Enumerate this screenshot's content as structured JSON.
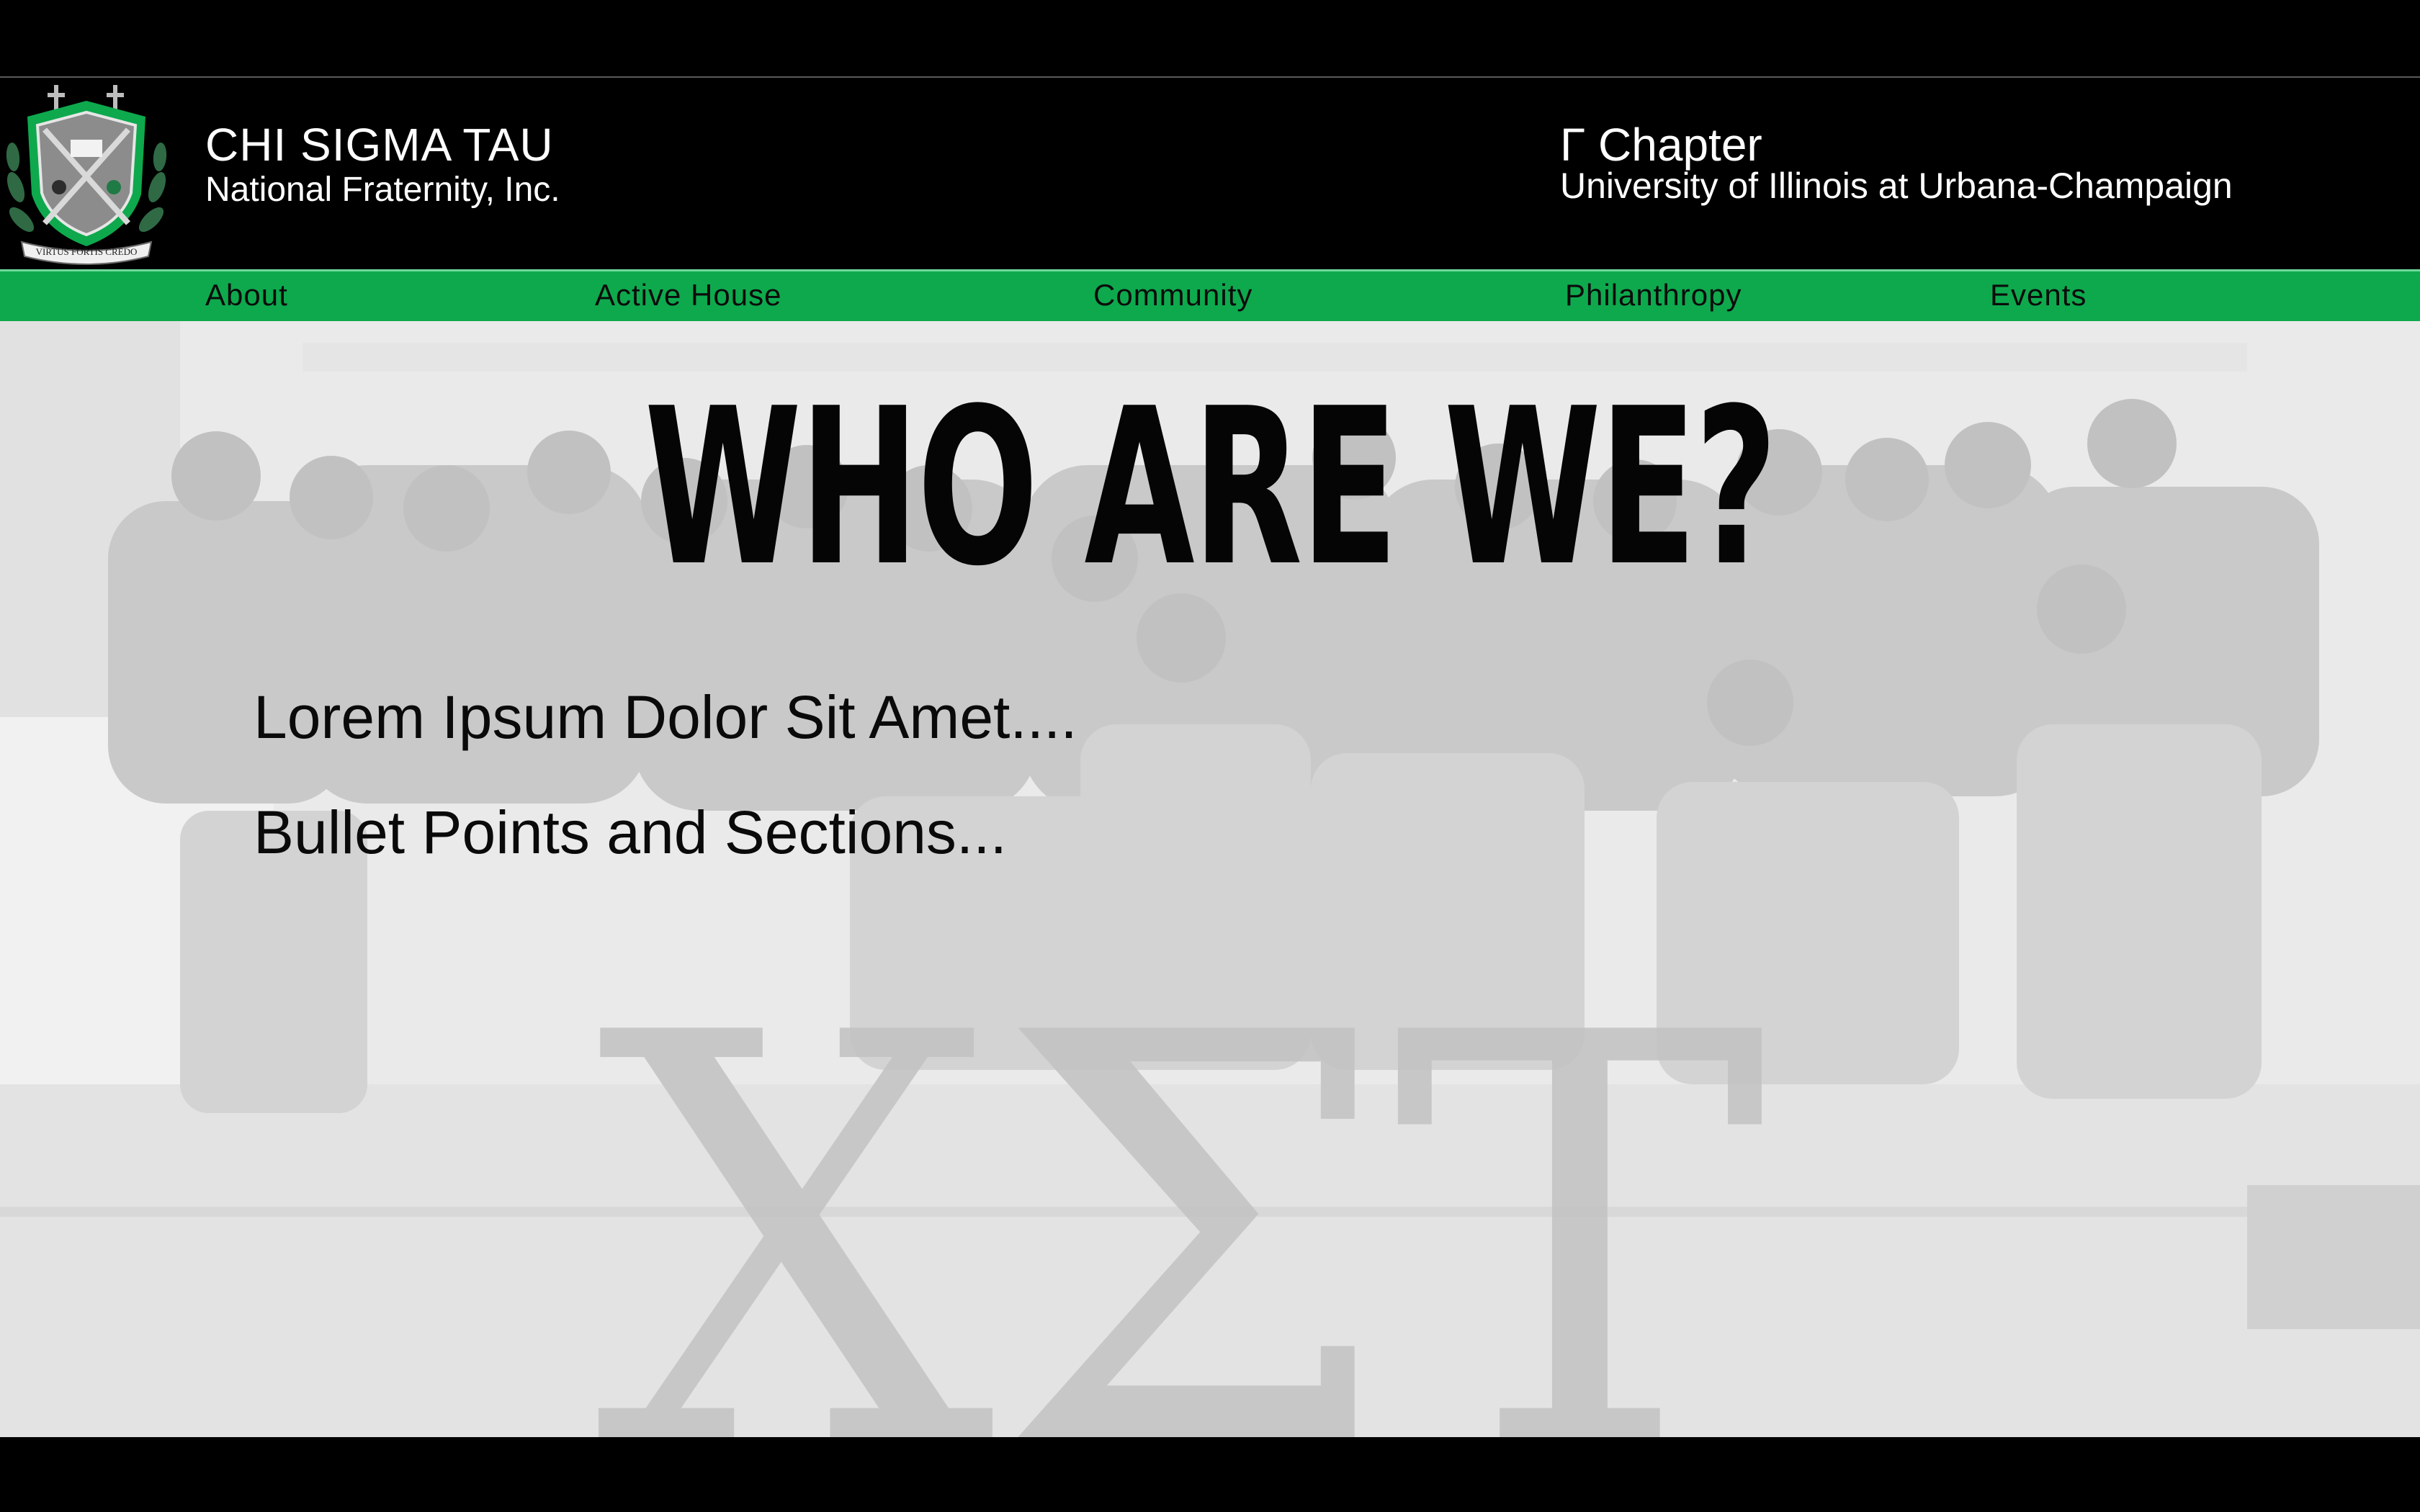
{
  "header": {
    "org_name": "CHI SIGMA TAU",
    "org_subtitle": "National Fraternity, Inc.",
    "chapter_name": "Γ Chapter",
    "chapter_subtitle": "University of Illinois at Urbana-Champaign",
    "crest": {
      "icon": "crest-icon",
      "motto": "VIRTUS FORTIS CREDO",
      "colors": {
        "green": "#0ea94d",
        "shield": "#8a8a8a"
      }
    }
  },
  "nav": {
    "items": [
      {
        "label": "About"
      },
      {
        "label": "Active House"
      },
      {
        "label": "Community"
      },
      {
        "label": "Philanthropy"
      },
      {
        "label": "Events"
      }
    ],
    "background": "#0ea94d"
  },
  "hero": {
    "headline": "WHO ARE WE?",
    "line_1": "Lorem Ipsum Dolor Sit Amet....",
    "line_2": "Bullet Points and Sections...",
    "background_letters": "ΧΣΤ",
    "image": "group-photo"
  }
}
